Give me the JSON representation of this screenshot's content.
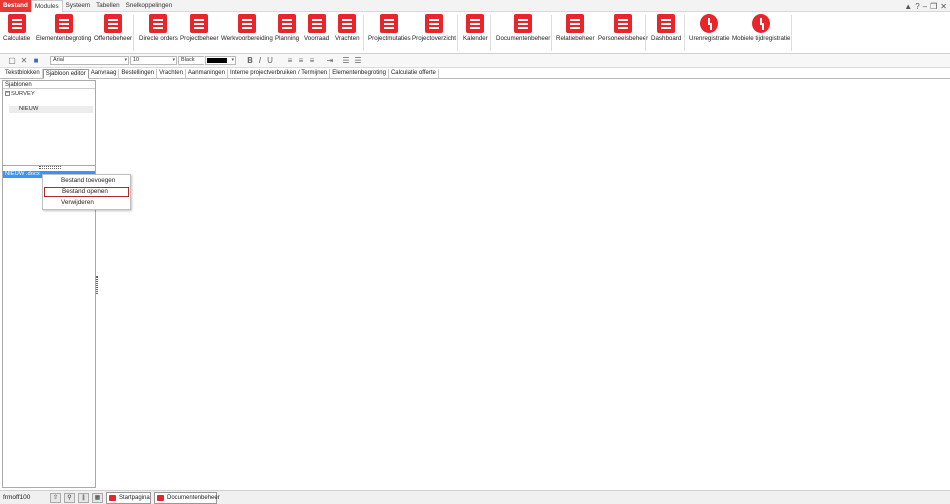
{
  "menubar": {
    "items": [
      "Bestand",
      "Modules",
      "Systeem",
      "Tabellen",
      "Snelkoppelingen"
    ],
    "controls": [
      "▲",
      "?",
      "–",
      "❐",
      "✕"
    ]
  },
  "ribbon": {
    "buttons": [
      {
        "label": "Calculatie",
        "icon": "calculator-icon"
      },
      {
        "label": "Elementenbegroting",
        "icon": "element-budget-icon"
      },
      {
        "label": "Offertebeheer",
        "icon": "quote-icon"
      },
      {
        "label": "Directe orders",
        "icon": "orders-icon"
      },
      {
        "label": "Projectbeheer",
        "icon": "project-icon"
      },
      {
        "label": "Werkvoorbereiding",
        "icon": "work-prep-icon"
      },
      {
        "label": "Planning",
        "icon": "planning-icon"
      },
      {
        "label": "Voorraad",
        "icon": "warehouse-icon"
      },
      {
        "label": "Vrachten",
        "icon": "truck-icon"
      },
      {
        "label": "Projectmutaties",
        "icon": "project-mutations-icon"
      },
      {
        "label": "Projectoverzicht",
        "icon": "project-overview-icon"
      },
      {
        "label": "Kalender",
        "icon": "calendar-icon"
      },
      {
        "label": "Documentenbeheer",
        "icon": "document-icon"
      },
      {
        "label": "Relatiebeheer",
        "icon": "relations-icon"
      },
      {
        "label": "Personeelsbeheer",
        "icon": "personnel-icon"
      },
      {
        "label": "Dashboard",
        "icon": "dashboard-icon"
      },
      {
        "label": "Urenregistratie",
        "icon": "clock-icon"
      },
      {
        "label": "Mobiele tijdregistratie",
        "icon": "clock-icon"
      }
    ]
  },
  "toolbar": {
    "font": "Arial",
    "size": "10",
    "color_name": "Black",
    "color_value": "#000000"
  },
  "tabs": [
    "Tekstblokken",
    "Sjabloon editor",
    "Aanvraag",
    "Bestellingen",
    "Vrachten",
    "Aanmaningen",
    "Interne projectverbruiken / Termijnen",
    "Elementenbegroting",
    "Calculatie offerte"
  ],
  "left_panel": {
    "header": "Sjablonen",
    "tree_root": "SURVEY",
    "tree_child": "NIEUW",
    "file": "NIEUW .docx"
  },
  "context_menu": {
    "items": [
      "Bestand toevoegen",
      "Bestand openen",
      "Verwijderen"
    ]
  },
  "statusbar": {
    "text": "frmoff100",
    "tasks": [
      "Startpagina",
      "Documentenbeheer"
    ]
  },
  "colors": {
    "accent": "#e8252a",
    "selection": "#3c95f3"
  }
}
